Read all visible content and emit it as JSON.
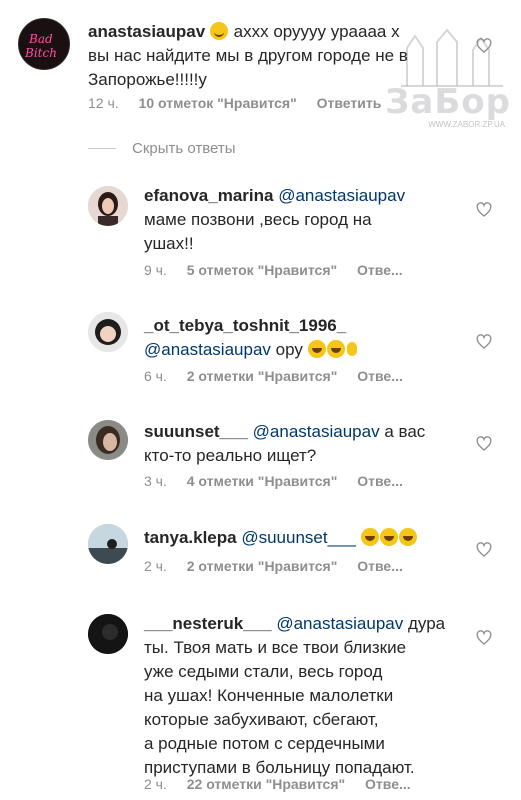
{
  "watermark": {
    "logo_text": "ЗаБор",
    "url": "WWW.ZABOR.ZP.UA"
  },
  "top_comment": {
    "avatar_text": "Bad Bitch",
    "username": "anastasiaupav",
    "line1": "аххх оруууу ураааа х",
    "line2": "вы нас найдите мы в другом городе не в",
    "line3": "Запорожье!!!!!у",
    "time": "12 ч.",
    "likes": "10 отметок \"Нравится\"",
    "reply": "Ответить"
  },
  "hide_replies": "Скрыть ответы",
  "replies": [
    {
      "username": "efanova_marina",
      "mention": "@anastasiaupav",
      "line1_rest": "",
      "line2": "маме позвони ,весь город на",
      "line3": "ушах!!",
      "time": "9 ч.",
      "likes": "5 отметок \"Нравится\"",
      "reply": "Отве..."
    },
    {
      "username": "_ot_tebya_toshnit_1996_",
      "mention": "@anastasiaupav",
      "line2": "ору",
      "time": "6 ч.",
      "likes": "2 отметки \"Нравится\"",
      "reply": "Отве..."
    },
    {
      "username": "suuunset___",
      "mention": "@anastasiaupav",
      "line1_rest": "а вас",
      "line2": "кто-то реально ищет?",
      "time": "3 ч.",
      "likes": "4 отметки \"Нравится\"",
      "reply": "Отве..."
    },
    {
      "username": "tanya.klepa",
      "mention": "@suuunset___",
      "time": "2 ч.",
      "likes": "2 отметки \"Нравится\"",
      "reply": "Отве..."
    },
    {
      "username": "___nesteruk___",
      "mention": "@anastasiaupav",
      "line1_rest": "дура",
      "line2": "ты. Твоя мать и все твои близкие",
      "line3": "уже седыми стали, весь город",
      "line4": "на ушах! Конченные малолетки",
      "line5": "которые забухивают, сбегают,",
      "line6": "а родные потом с сердечными",
      "line7": "приступами в больницу попадают.",
      "time": "2 ч.",
      "likes": "22 отметки \"Нравится\"",
      "reply": "Отве..."
    }
  ],
  "colors": {
    "username": "#262626",
    "meta": "#8e8e8e",
    "mention": "#00376b",
    "avatar_neon": "#ff4fa3"
  }
}
